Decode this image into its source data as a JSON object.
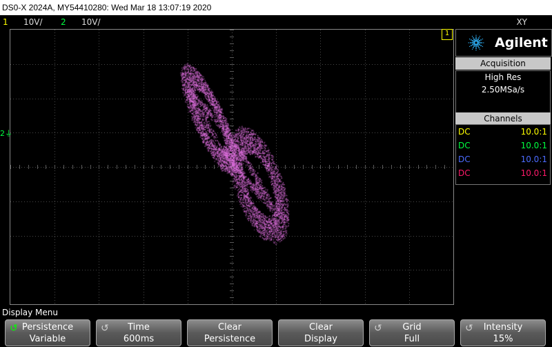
{
  "title_bar": "DS0-X 2024A, MY54410280: Wed Mar 18 13:07:19 2020",
  "channels_bar": {
    "ch1_num": "1",
    "ch1_scale": "10V/",
    "ch2_num": "2",
    "ch2_scale": "10V/",
    "mode": "XY"
  },
  "markers": {
    "ch1": "1",
    "ch2": "2"
  },
  "brand": "Agilent",
  "acquisition": {
    "title": "Acquisition",
    "mode": "High Res",
    "rate": "2.50MSa/s"
  },
  "channels_panel": {
    "title": "Channels",
    "rows": [
      {
        "coupling": "DC",
        "probe": "10.0:1",
        "color": "#ffff00"
      },
      {
        "coupling": "DC",
        "probe": "10.0:1",
        "color": "#00ff40"
      },
      {
        "coupling": "DC",
        "probe": "10.0:1",
        "color": "#4c6cff"
      },
      {
        "coupling": "DC",
        "probe": "10.0:1",
        "color": "#ff1a6a"
      }
    ]
  },
  "menu_title": "Display Menu",
  "softkeys": [
    {
      "line1": "Persistence",
      "line2": "Variable",
      "knob": true,
      "knob_active": true
    },
    {
      "line1": "Time",
      "line2": "600ms",
      "knob": true,
      "knob_active": false
    },
    {
      "line1": "Clear",
      "line2": "Persistence",
      "knob": false
    },
    {
      "line1": "Clear",
      "line2": "Display",
      "knob": false
    },
    {
      "line1": "Grid",
      "line2": "Full",
      "knob": true,
      "knob_active": false
    },
    {
      "line1": "Intensity",
      "line2": "15%",
      "knob": true,
      "knob_active": false
    }
  ],
  "colors": {
    "trace": "#e070e0",
    "ch1": "#ffff00",
    "ch2": "#00ff40"
  }
}
